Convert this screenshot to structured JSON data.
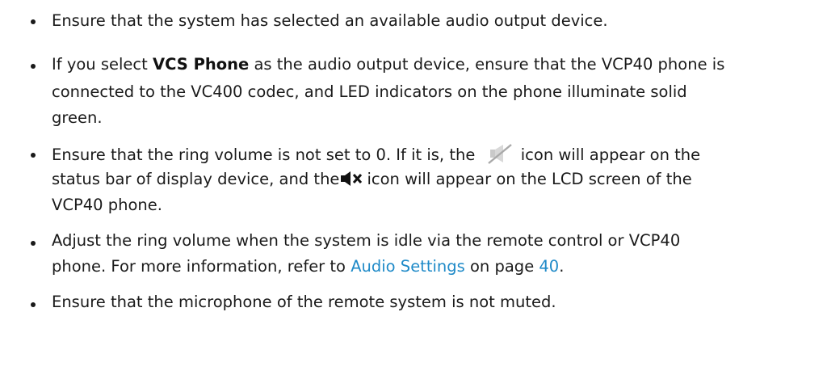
{
  "items": [
    {
      "text": "Ensure that the system has selected an available audio output device."
    },
    {
      "line1_pre": "If you select ",
      "line1_bold": "VCS Phone",
      "line1_post": " as the audio output device, ensure that the VCP40 phone is",
      "line2": "connected to the VC400 codec, and LED indicators on the phone illuminate solid",
      "line3": "green."
    },
    {
      "line1_pre": "Ensure that the ring volume is not set to 0. If it is, the",
      "line1_post": "icon will appear on the",
      "line2_pre": "status bar of display device, and the",
      "line2_post": "icon will appear on the LCD screen of the",
      "line3": "VCP40 phone.",
      "icon1": "speaker-off-icon",
      "icon2": "mute-speaker-icon"
    },
    {
      "line1": "Adjust the ring volume when the system is idle via the remote control or VCP40",
      "line2_pre": "phone. For more information, refer to ",
      "line2_link": "Audio Settings",
      "line2_mid": " on page ",
      "line2_page": "40",
      "line2_post": "."
    },
    {
      "text": "Ensure that the microphone of the remote system is not muted."
    }
  ],
  "colors": {
    "text": "#1a1a1a",
    "link": "#1f8ac8"
  }
}
